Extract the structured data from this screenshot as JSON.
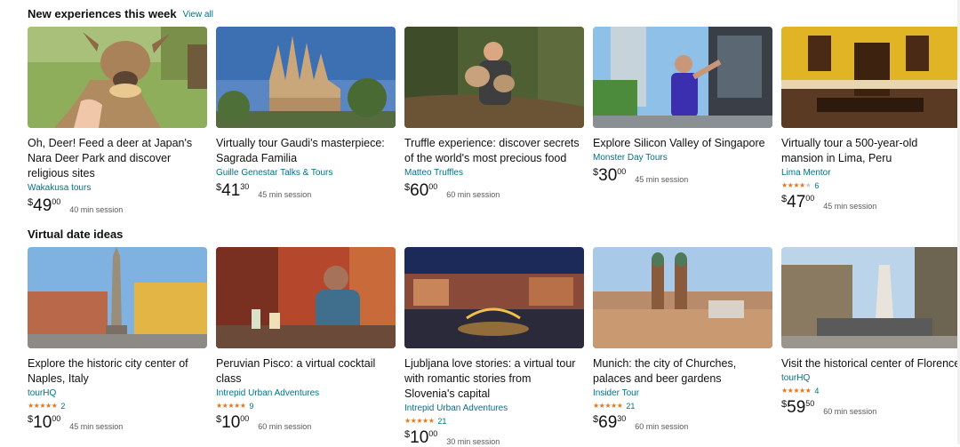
{
  "sections": [
    {
      "title": "New experiences this week",
      "view_all": "View all",
      "cards": [
        {
          "title": "Oh, Deer! Feed a deer at Japan's Nara Deer Park and discover religious sites",
          "vendor": "Wakakusa tours",
          "rating": null,
          "reviews": null,
          "price_symbol": "$",
          "price_whole": "49",
          "price_fraction": "00",
          "session": "40 min session",
          "image": "deer-feeding-photo"
        },
        {
          "title": "Virtually tour Gaudi's masterpiece: Sagrada Familia",
          "vendor": "Guille Genestar Talks & Tours",
          "rating": null,
          "reviews": null,
          "price_symbol": "$",
          "price_whole": "41",
          "price_fraction": "30",
          "session": "45 min session",
          "image": "sagrada-familia-photo"
        },
        {
          "title": "Truffle experience: discover secrets of the world's most precious food",
          "vendor": "Matteo Truffles",
          "rating": null,
          "reviews": null,
          "price_symbol": "$",
          "price_whole": "60",
          "price_fraction": "00",
          "session": "60 min session",
          "image": "truffle-dog-photo"
        },
        {
          "title": "Explore Silicon Valley of Singapore",
          "vendor": "Monster Day Tours",
          "rating": null,
          "reviews": null,
          "price_symbol": "$",
          "price_whole": "30",
          "price_fraction": "00",
          "session": "45 min session",
          "image": "singapore-guide-photo"
        },
        {
          "title": "Virtually tour a 500-year-old mansion in Lima, Peru",
          "vendor": "Lima Mentor",
          "rating": 4,
          "reviews": "6",
          "price_symbol": "$",
          "price_whole": "47",
          "price_fraction": "00",
          "session": "45 min session",
          "image": "lima-mansion-photo"
        }
      ]
    },
    {
      "title": "Virtual date ideas",
      "view_all": null,
      "cards": [
        {
          "title": "Explore the historic city center of Naples, Italy",
          "vendor": "tourHQ",
          "rating": 5,
          "reviews": "2",
          "price_symbol": "$",
          "price_whole": "10",
          "price_fraction": "00",
          "session": "45 min session",
          "image": "naples-square-photo"
        },
        {
          "title": "Peruvian Pisco: a virtual cocktail class",
          "vendor": "Intrepid Urban Adventures",
          "rating": 5,
          "reviews": "9",
          "price_symbol": "$",
          "price_whole": "10",
          "price_fraction": "00",
          "session": "60 min session",
          "image": "pisco-bartender-photo"
        },
        {
          "title": "Ljubljana love stories: a virtual tour with romantic stories from Slovenia's capital",
          "vendor": "Intrepid Urban Adventures",
          "rating": 5,
          "reviews": "21",
          "price_symbol": "$",
          "price_whole": "10",
          "price_fraction": "00",
          "session": "30 min session",
          "image": "ljubljana-night-photo"
        },
        {
          "title": "Munich: the city of Churches, palaces and beer gardens",
          "vendor": "Insider Tour",
          "rating": 5,
          "reviews": "21",
          "price_symbol": "$",
          "price_whole": "69",
          "price_fraction": "30",
          "session": "60 min session",
          "image": "munich-skyline-photo"
        },
        {
          "title": "Visit the historical center of Florence",
          "vendor": "tourHQ",
          "rating": 5,
          "reviews": "4",
          "price_symbol": "$",
          "price_whole": "59",
          "price_fraction": "50",
          "session": "60 min session",
          "image": "florence-fountain-photo"
        }
      ]
    }
  ],
  "colors": {
    "link": "#007185",
    "star": "#de7921",
    "muted": "#565959",
    "text": "#0f1111"
  }
}
